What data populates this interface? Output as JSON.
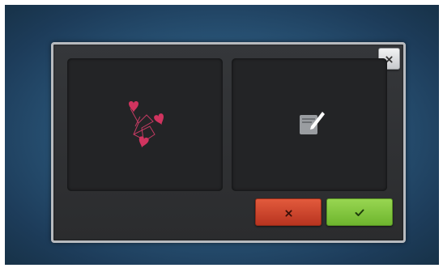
{
  "dialog": {
    "close_icon": "close-icon",
    "panels": [
      {
        "id": "design-preview",
        "icon": "hearts-embroidery-design-icon",
        "colors": {
          "hearts": "#d0345f",
          "stitch": "#c23a62"
        }
      },
      {
        "id": "edit-design",
        "icon": "edit-note-icon",
        "colors": {
          "note": "#9a9da1",
          "pencil": "#ffffff"
        }
      }
    ],
    "buttons": {
      "cancel": {
        "icon": "x-icon",
        "color": "#d24a30"
      },
      "confirm": {
        "icon": "checkmark-icon",
        "color": "#86c93f"
      }
    }
  },
  "colors": {
    "background": "#2a5679",
    "dialog": "#2f3032",
    "panel": "#232426",
    "border": "#b8bbbf"
  }
}
